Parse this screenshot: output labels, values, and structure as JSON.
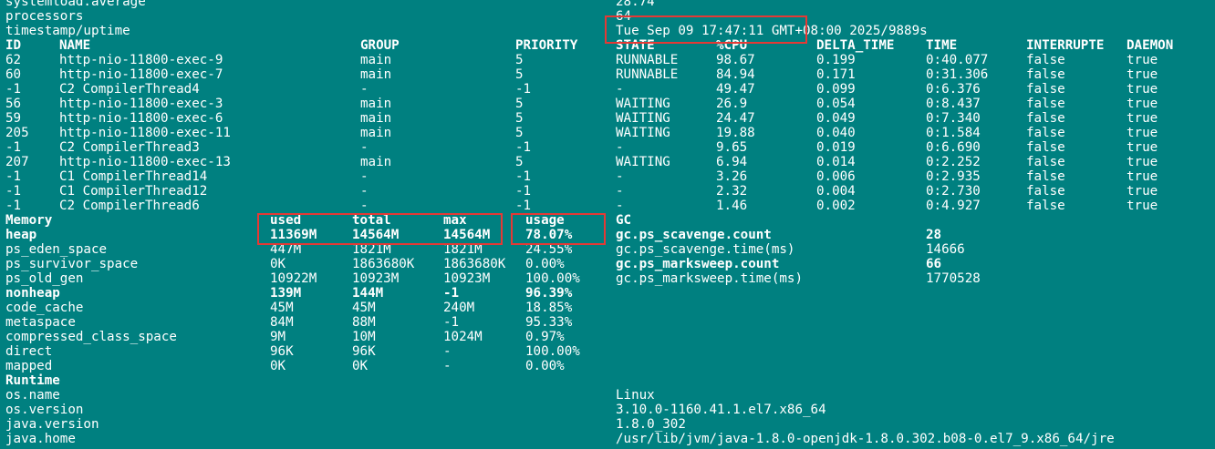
{
  "top": [
    {
      "label": "systemload.average",
      "value": "28.74"
    },
    {
      "label": "processors",
      "value": "64"
    },
    {
      "label": "timestamp/uptime",
      "value": "Tue Sep 09 17:47:11 GMT+08:00 2025/9889s"
    }
  ],
  "threads": {
    "headers": [
      "ID",
      "NAME",
      "GROUP",
      "PRIORITY",
      "STATE",
      "%CPU",
      "DELTA_TIME",
      "TIME",
      "INTERRUPTE",
      "DAEMON"
    ],
    "rows": [
      [
        "62",
        "http-nio-11800-exec-9",
        "main",
        "5",
        "RUNNABLE",
        "98.67",
        "0.199",
        "0:40.077",
        "false",
        "true"
      ],
      [
        "60",
        "http-nio-11800-exec-7",
        "main",
        "5",
        "RUNNABLE",
        "84.94",
        "0.171",
        "0:31.306",
        "false",
        "true"
      ],
      [
        "-1",
        "C2 CompilerThread4",
        "-",
        "-1",
        "-",
        "49.47",
        "0.099",
        "0:6.376",
        "false",
        "true"
      ],
      [
        "56",
        "http-nio-11800-exec-3",
        "main",
        "5",
        "WAITING",
        "26.9",
        "0.054",
        "0:8.437",
        "false",
        "true"
      ],
      [
        "59",
        "http-nio-11800-exec-6",
        "main",
        "5",
        "WAITING",
        "24.47",
        "0.049",
        "0:7.340",
        "false",
        "true"
      ],
      [
        "205",
        "http-nio-11800-exec-11",
        "main",
        "5",
        "WAITING",
        "19.88",
        "0.040",
        "0:1.584",
        "false",
        "true"
      ],
      [
        "-1",
        "C2 CompilerThread3",
        "-",
        "-1",
        "-",
        "9.65",
        "0.019",
        "0:6.690",
        "false",
        "true"
      ],
      [
        "207",
        "http-nio-11800-exec-13",
        "main",
        "5",
        "WAITING",
        "6.94",
        "0.014",
        "0:2.252",
        "false",
        "true"
      ],
      [
        "-1",
        "C1 CompilerThread14",
        "-",
        "-1",
        "-",
        "3.26",
        "0.006",
        "0:2.935",
        "false",
        "true"
      ],
      [
        "-1",
        "C1 CompilerThread12",
        "-",
        "-1",
        "-",
        "2.32",
        "0.004",
        "0:2.730",
        "false",
        "true"
      ],
      [
        "-1",
        "C2 CompilerThread6",
        "-",
        "-1",
        "-",
        "1.46",
        "0.002",
        "0:4.927",
        "false",
        "true"
      ]
    ]
  },
  "memory": {
    "headers": [
      "Memory",
      "used",
      "total",
      "max",
      "usage"
    ],
    "rows": [
      {
        "cells": [
          "heap",
          "11369M",
          "14564M",
          "14564M",
          "78.07%"
        ],
        "bold": true
      },
      {
        "cells": [
          "ps_eden_space",
          "447M",
          "1821M",
          "1821M",
          "24.55%"
        ],
        "bold": false
      },
      {
        "cells": [
          "ps_survivor_space",
          "0K",
          "1863680K",
          "1863680K",
          "0.00%"
        ],
        "bold": false
      },
      {
        "cells": [
          "ps_old_gen",
          "10922M",
          "10923M",
          "10923M",
          "100.00%"
        ],
        "bold": false
      },
      {
        "cells": [
          "nonheap",
          "139M",
          "144M",
          "-1",
          "96.39%"
        ],
        "bold": true
      },
      {
        "cells": [
          "code_cache",
          "45M",
          "45M",
          "240M",
          "18.85%"
        ],
        "bold": false
      },
      {
        "cells": [
          "metaspace",
          "84M",
          "88M",
          "-1",
          "95.33%"
        ],
        "bold": false
      },
      {
        "cells": [
          "compressed_class_space",
          "9M",
          "10M",
          "1024M",
          "0.97%"
        ],
        "bold": false
      },
      {
        "cells": [
          "direct",
          "96K",
          "96K",
          "-",
          "100.00%"
        ],
        "bold": false
      },
      {
        "cells": [
          "mapped",
          "0K",
          "0K",
          "-",
          "0.00%"
        ],
        "bold": false
      }
    ]
  },
  "gc": {
    "header": "GC",
    "rows": [
      {
        "label": "gc.ps_scavenge.count",
        "value": "28",
        "bold": true
      },
      {
        "label": "gc.ps_scavenge.time(ms)",
        "value": "14666",
        "bold": false
      },
      {
        "label": "gc.ps_marksweep.count",
        "value": "66",
        "bold": true
      },
      {
        "label": "gc.ps_marksweep.time(ms)",
        "value": "1770528",
        "bold": false
      }
    ]
  },
  "runtime": {
    "header": "Runtime",
    "rows": [
      {
        "label": "os.name",
        "value": "Linux"
      },
      {
        "label": "os.version",
        "value": "3.10.0-1160.41.1.el7.x86_64"
      },
      {
        "label": "java.version",
        "value": "1.8.0_302"
      },
      {
        "label": "java.home",
        "value": "/usr/lib/jvm/java-1.8.0-openjdk-1.8.0.302.b08-0.el7_9.x86_64/jre"
      }
    ]
  },
  "highlight_color": "#e53935"
}
